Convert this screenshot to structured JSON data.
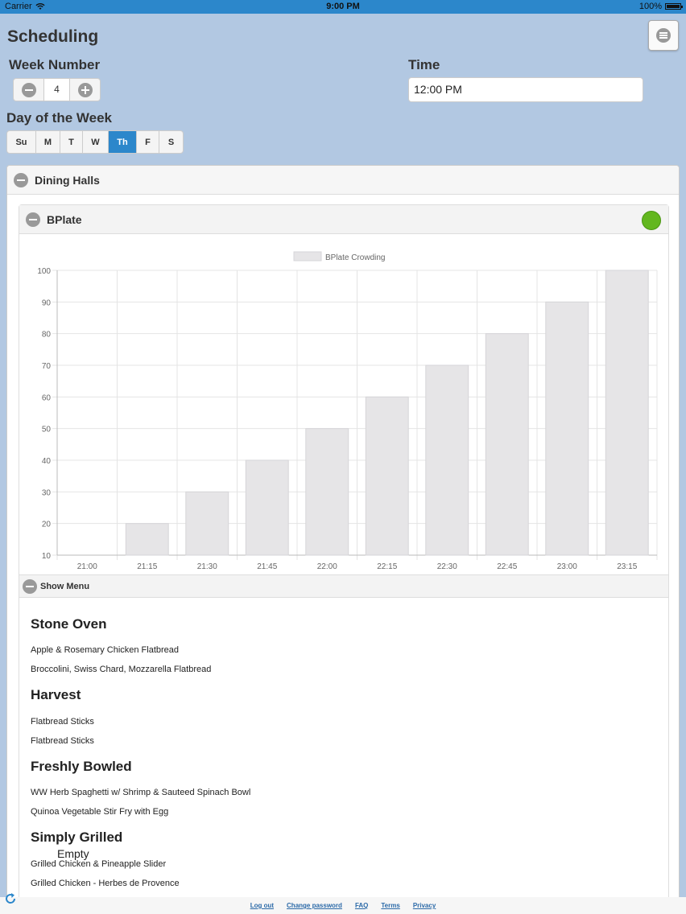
{
  "status_bar": {
    "carrier": "Carrier",
    "time": "9:00 PM",
    "battery": "100%"
  },
  "header": {
    "title": "Scheduling"
  },
  "week": {
    "label": "Week Number",
    "value": "4"
  },
  "time": {
    "label": "Time",
    "value": "12:00 PM"
  },
  "day_of_week": {
    "label": "Day of the Week",
    "days": [
      "Su",
      "M",
      "T",
      "W",
      "Th",
      "F",
      "S"
    ],
    "selected": "Th"
  },
  "dining_halls": {
    "title": "Dining Halls",
    "hall": {
      "name": "BPlate",
      "status_color": "#63b71f"
    },
    "show_menu_label": "Show Menu",
    "menu": {
      "stations": [
        {
          "name": "Stone Oven",
          "items": [
            "Apple & Rosemary Chicken Flatbread",
            "Broccolini, Swiss Chard, Mozzarella Flatbread"
          ]
        },
        {
          "name": "Harvest",
          "items": [
            "Flatbread Sticks",
            "Flatbread Sticks"
          ]
        },
        {
          "name": "Freshly Bowled",
          "items": [
            "WW Herb Spaghetti w/ Shrimp & Sauteed Spinach Bowl",
            "Quinoa Vegetable Stir Fry with Egg"
          ]
        },
        {
          "name": "Simply Grilled",
          "note": "Empty",
          "items": [
            "Grilled Chicken & Pineapple Slider",
            "Grilled Chicken - Herbes de Provence"
          ]
        }
      ]
    }
  },
  "chart_data": {
    "type": "bar",
    "legend": "BPlate Crowding",
    "categories": [
      "21:00",
      "21:15",
      "21:30",
      "21:45",
      "22:00",
      "22:15",
      "22:30",
      "22:45",
      "23:00",
      "23:15"
    ],
    "values": [
      10,
      20,
      30,
      40,
      50,
      60,
      70,
      80,
      90,
      100
    ],
    "ylim": [
      10,
      100
    ],
    "yticks": [
      10,
      20,
      30,
      40,
      50,
      60,
      70,
      80,
      90,
      100
    ],
    "grid": true,
    "bar_color": "#e6e5e7",
    "bar_border": "#d6d5d8"
  },
  "footer": {
    "links": [
      "Log out",
      "Change password",
      "FAQ",
      "Terms",
      "Privacy"
    ]
  }
}
